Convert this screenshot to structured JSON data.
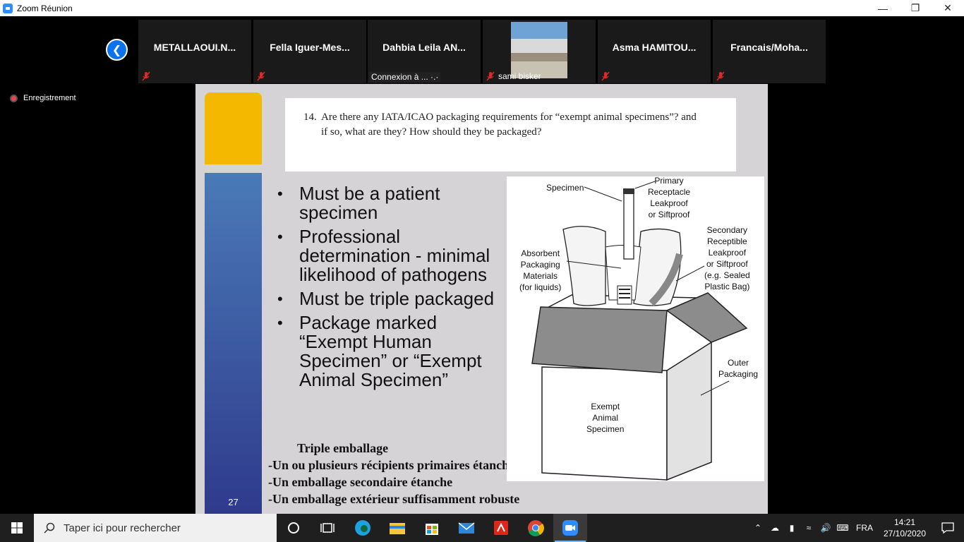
{
  "window": {
    "title": "Zoom Réunion",
    "controls": [
      "—",
      "❐",
      "✕"
    ]
  },
  "participants": [
    {
      "name": "METALLAOUI.N...",
      "muted": true
    },
    {
      "name": "Fella  Iguer-Mes...",
      "muted": true
    },
    {
      "name": "Dahbia  Leila  AN...",
      "status": "Connexion à ... ·.·"
    },
    {
      "label": "sami bisker",
      "muted": true,
      "has_video": true
    },
    {
      "name": "Asma  HAMITOU...",
      "muted": true
    },
    {
      "name": "Francais/Moha...",
      "muted": true
    }
  ],
  "recording": {
    "label": "Enregistrement"
  },
  "slide": {
    "page_number": "27",
    "question_number": "14.",
    "question": "Are there any IATA/ICAO packaging requirements for “exempt animal specimens”? and if so, what are they? How should they be packaged?",
    "bullets": [
      "Must be a patient specimen",
      "Professional determination - minimal likelihood of pathogens",
      "Must be triple packaged",
      "Package marked “Exempt Human Specimen” or “Exempt Animal Specimen”"
    ],
    "french": {
      "title": "Triple emballage",
      "lines": [
        "-Un ou plusieurs récipients primaires étanches",
        "-Un emballage secondaire étanche",
        "-Un emballage extérieur suffisamment robuste"
      ]
    },
    "figure_labels": {
      "specimen": "Specimen",
      "primary": [
        "Primary",
        "Receptacle",
        "Leakproof",
        "or Siftproof"
      ],
      "secondary": [
        "Secondary",
        "Receptible",
        "Leakproof",
        "or Siftproof",
        "(e.g. Sealed",
        "Plastic Bag)"
      ],
      "absorbent": [
        "Absorbent",
        "Packaging",
        "Materials",
        "(for liquids)"
      ],
      "outer": [
        "Outer",
        "Packaging"
      ],
      "exempt": [
        "Exempt",
        "Animal",
        "Specimen"
      ]
    }
  },
  "taskbar": {
    "search_placeholder": "Taper ici pour rechercher",
    "language": "FRA",
    "time": "14:21",
    "date": "27/10/2020"
  }
}
